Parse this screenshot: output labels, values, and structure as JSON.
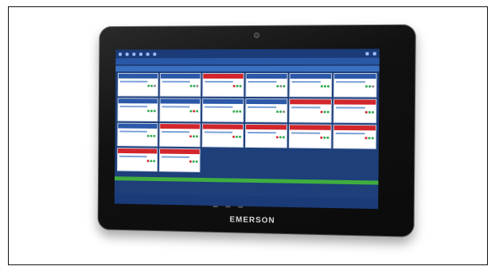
{
  "brand": {
    "text": "EMERSON"
  }
}
